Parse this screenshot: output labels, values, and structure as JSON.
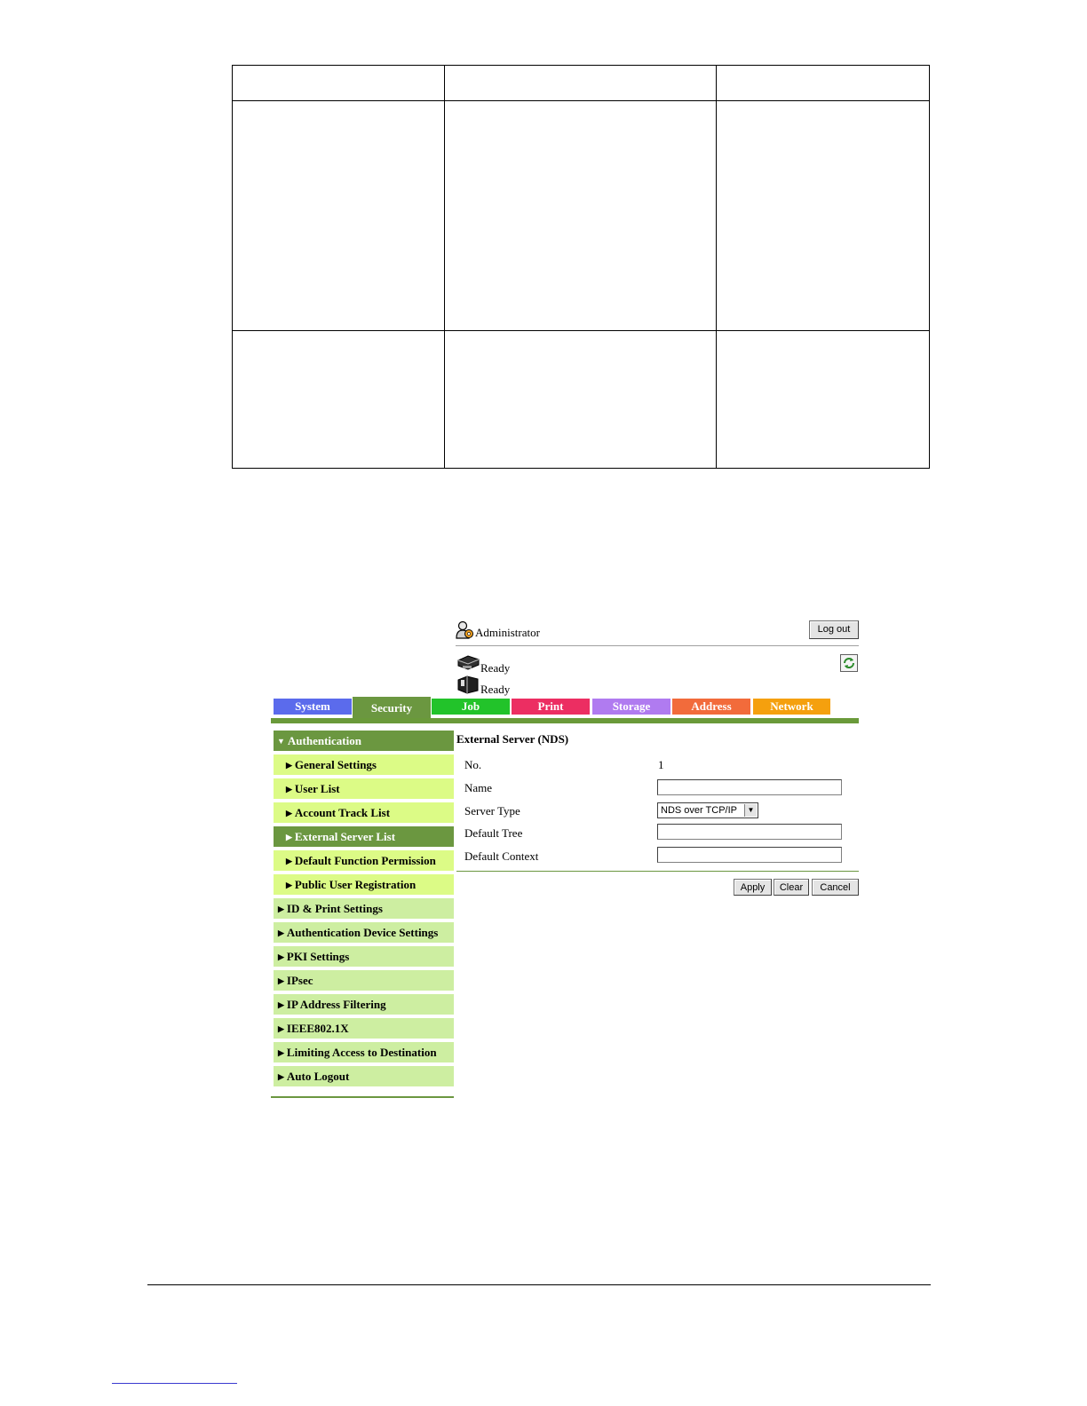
{
  "header": {
    "user_label": "Administrator",
    "logout_label": "Log out",
    "status_1": "Ready",
    "status_2": "Ready"
  },
  "tabs": [
    {
      "label": "System",
      "color": "#5b6bec"
    },
    {
      "label": "Security",
      "color": "#6b9740"
    },
    {
      "label": "Job",
      "color": "#22c32a"
    },
    {
      "label": "Print",
      "color": "#ec2e62"
    },
    {
      "label": "Storage",
      "color": "#b07bf0"
    },
    {
      "label": "Address",
      "color": "#f26b3b"
    },
    {
      "label": "Network",
      "color": "#f5a00e"
    }
  ],
  "sidebar": {
    "items": [
      {
        "label": "Authentication"
      },
      {
        "label": "General Settings"
      },
      {
        "label": "User List"
      },
      {
        "label": "Account Track List"
      },
      {
        "label": "External Server List"
      },
      {
        "label": "Default Function Permission"
      },
      {
        "label": "Public User Registration"
      },
      {
        "label": "ID & Print Settings"
      },
      {
        "label": "Authentication Device Settings"
      },
      {
        "label": "PKI Settings"
      },
      {
        "label": "IPsec"
      },
      {
        "label": "IP Address Filtering"
      },
      {
        "label": "IEEE802.1X"
      },
      {
        "label": "Limiting Access to Destination"
      },
      {
        "label": "Auto Logout"
      }
    ]
  },
  "form": {
    "title": "External Server (NDS)",
    "no_label": "No.",
    "no_value": "1",
    "name_label": "Name",
    "name_value": "",
    "server_type_label": "Server Type",
    "server_type_value": "NDS over TCP/IP",
    "default_tree_label": "Default Tree",
    "default_tree_value": "",
    "default_context_label": "Default Context",
    "default_context_value": "",
    "apply_label": "Apply",
    "clear_label": "Clear",
    "cancel_label": "Cancel"
  }
}
